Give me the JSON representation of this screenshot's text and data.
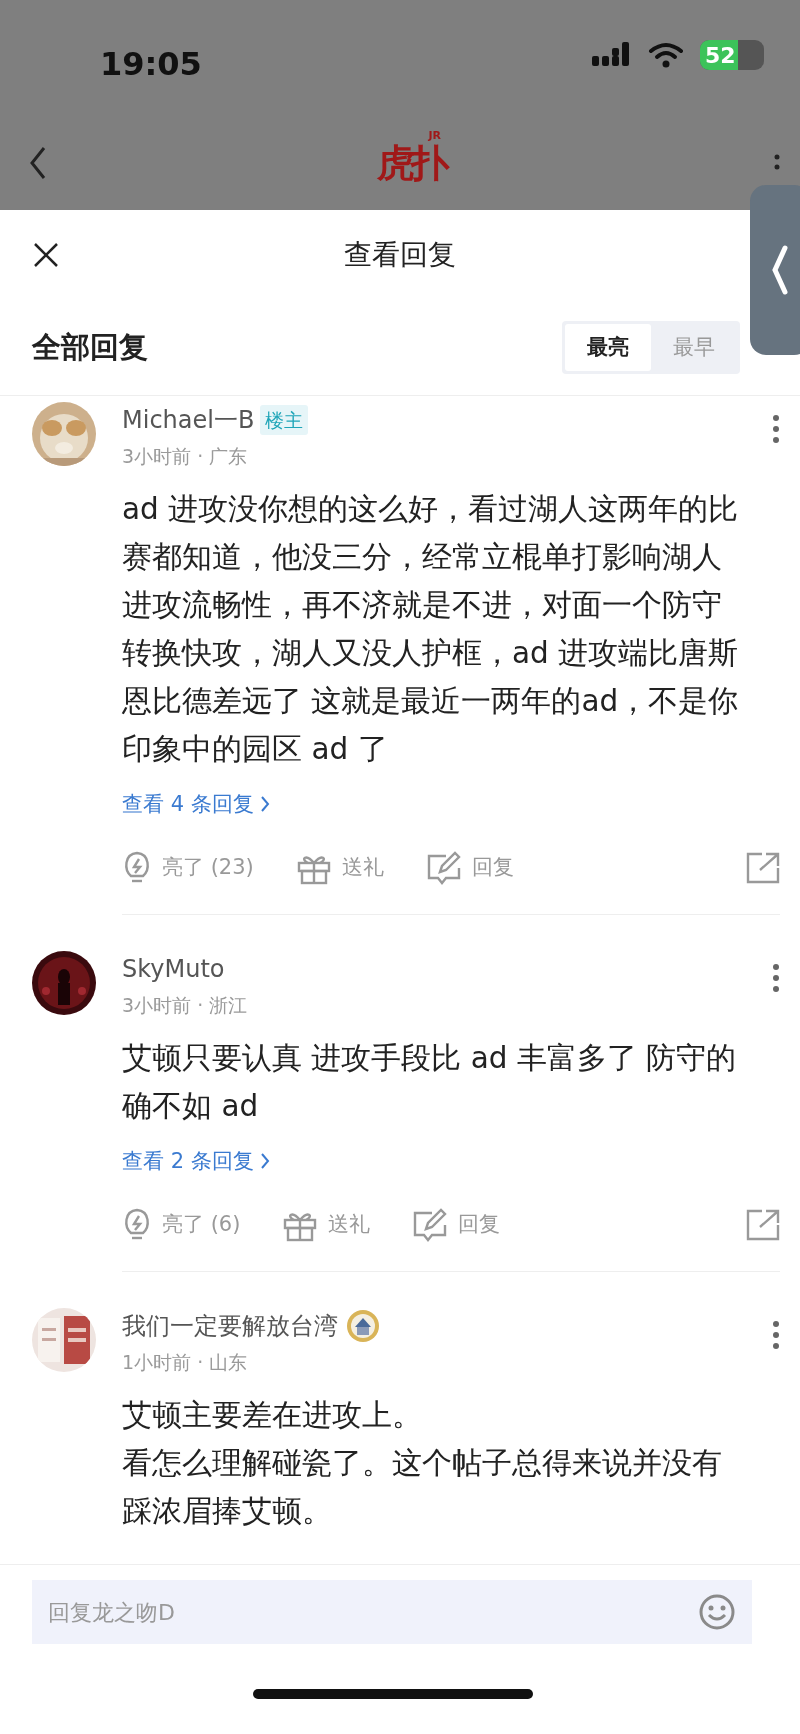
{
  "status_bar": {
    "time": "19:05",
    "battery": "52"
  },
  "app_bar": {
    "logo": "虎扑",
    "logo_mark": "JR"
  },
  "sheet": {
    "title": "查看回复",
    "section_title": "全部回复",
    "sort_tabs": [
      {
        "label": "最亮",
        "selected": true
      },
      {
        "label": "最早",
        "selected": false
      }
    ]
  },
  "comments": [
    {
      "user": "Michael一B",
      "badge": "楼主",
      "medal": false,
      "meta": "3小时前 · 广东",
      "body": "ad 进攻没你想的这么好，看过湖人这两年的比赛都知道，他没三分，经常立棍单打影响湖人进攻流畅性，再不济就是不进，对面一个防守转换快攻，湖人又没人护框，ad 进攻端比唐斯恩比德差远了  这就是最近一两年的ad，不是你印象中的园区 ad 了",
      "replies_link": "查看 4 条回复",
      "likes": "亮了 (23)",
      "gift": "送礼",
      "reply": "回复"
    },
    {
      "user": "SkyMuto",
      "medal": false,
      "meta": "3小时前 · 浙江",
      "body": "艾顿只要认真 进攻手段比 ad 丰富多了 防守的确不如 ad",
      "replies_link": "查看 2 条回复",
      "likes": "亮了 (6)",
      "gift": "送礼",
      "reply": "回复"
    },
    {
      "user": "我们一定要解放台湾",
      "medal": true,
      "meta": "1小时前 · 山东",
      "body": "艾顿主要差在进攻上。",
      "body_2": "看怎么理解碰瓷了。这个帖子总得来说并没有踩浓眉捧艾顿。"
    }
  ],
  "reply_input": {
    "placeholder": "回复龙之吻D"
  }
}
